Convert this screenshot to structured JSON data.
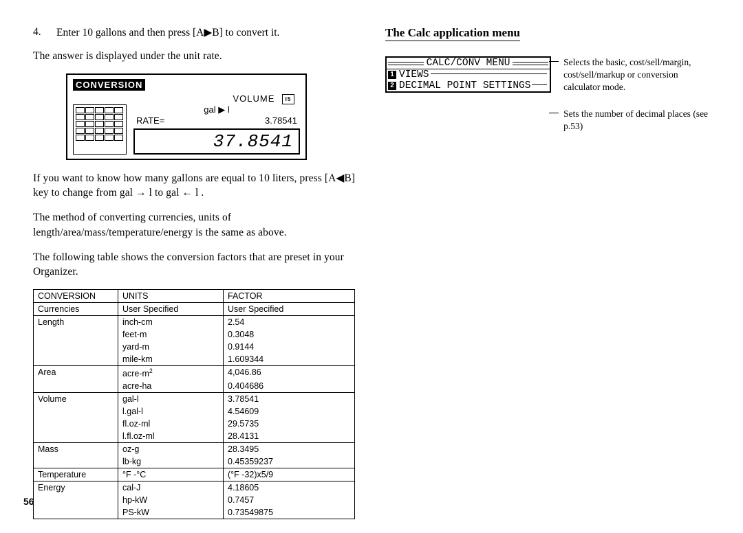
{
  "page_number": "56",
  "left": {
    "step_num": "4.",
    "step_text": "Enter 10 gallons and then press [A▶B] to convert it.",
    "answer_line": "The answer is displayed under the unit rate.",
    "lcd": {
      "title": "CONVERSION",
      "volume_label": "VOLUME",
      "unit_pair": "gal ▶ l",
      "rate_label": "RATE=",
      "rate_value": "3.78541",
      "result": "37.8541"
    },
    "para2a": "If you want to know how many gallons are equal to 10 liters, press [A◀B] key to change from gal → l to gal ← l .",
    "para3": "The method of converting currencies, units of length/area/mass/temperature/energy is the same as above.",
    "para4": "The following table shows the conversion factors that are preset in your Organizer.",
    "table_header": {
      "c1": "CONVERSION",
      "c2": "UNITS",
      "c3": "FACTOR"
    },
    "table_groups": [
      {
        "cat": "Currencies",
        "rows": [
          [
            "User Specified",
            "User Specified"
          ]
        ]
      },
      {
        "cat": "Length",
        "rows": [
          [
            "inch-cm",
            "2.54"
          ],
          [
            "feet-m",
            "0.3048"
          ],
          [
            "yard-m",
            "0.9144"
          ],
          [
            "mile-km",
            "1.609344"
          ]
        ]
      },
      {
        "cat": "Area",
        "rows": [
          [
            "acre-m²",
            "4,046.86"
          ],
          [
            "acre-ha",
            "0.404686"
          ]
        ]
      },
      {
        "cat": "Volume",
        "rows": [
          [
            "gal-l",
            "3.78541"
          ],
          [
            "l.gal-l",
            "4.54609"
          ],
          [
            "fl.oz-ml",
            "29.5735"
          ],
          [
            "l.fl.oz-ml",
            "28.4131"
          ]
        ]
      },
      {
        "cat": "Mass",
        "rows": [
          [
            "oz-g",
            "28.3495"
          ],
          [
            "lb-kg",
            "0.45359237"
          ]
        ]
      },
      {
        "cat": "Temperature",
        "rows": [
          [
            "°F -°C",
            "(°F -32)x5/9"
          ]
        ]
      },
      {
        "cat": "Energy",
        "rows": [
          [
            "cal-J",
            "4.18605"
          ],
          [
            "hp-kW",
            "0.7457"
          ],
          [
            "PS-kW",
            "0.73549875"
          ]
        ]
      }
    ]
  },
  "right": {
    "heading": "The Calc application menu",
    "menu": {
      "title": "CALC/CONV MENU",
      "item1_num": "1",
      "item1_label": "VIEWS",
      "item2_num": "2",
      "item2_label": "DECIMAL POINT SETTINGS"
    },
    "callout1": "Selects the basic, cost/sell/margin, cost/sell/markup or conversion calculator mode.",
    "callout2": "Sets the number of decimal places (see p.53)"
  }
}
